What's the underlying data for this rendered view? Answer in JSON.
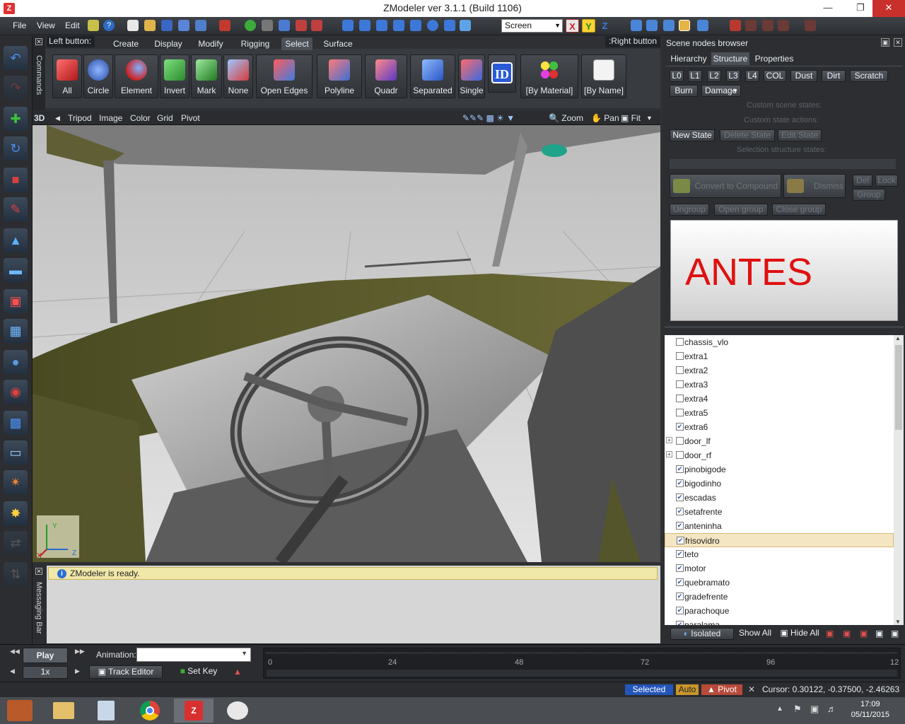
{
  "window": {
    "title": "ZModeler ver 3.1.1 (Build 1106)"
  },
  "menubar": {
    "items": [
      "File",
      "View",
      "Edit"
    ],
    "screen_dropdown": "Screen",
    "axes": [
      "X",
      "Y",
      "Z"
    ]
  },
  "commands_panel": {
    "vertical_label": "Commands",
    "left_button_label": "Left button:",
    "right_button_label": ":Right button",
    "tabs": [
      "Create",
      "Display",
      "Modify",
      "Rigging",
      "Select",
      "Surface"
    ],
    "active_tab": "Select",
    "buttons": [
      "All",
      "Circle",
      "Element",
      "Invert",
      "Mark",
      "None",
      "Open Edges",
      "Polyline",
      "Quadr",
      "Separated",
      "Single",
      "ID",
      "[By Material]",
      "[By Name]"
    ]
  },
  "viewport": {
    "mode": "3D",
    "menu": [
      "Tripod",
      "Image",
      "Color",
      "Grid",
      "Pivot"
    ],
    "right_tools": [
      "Zoom",
      "Pan",
      "Fit"
    ],
    "axes_gizmo": {
      "x": "X",
      "y": "Y",
      "z": "Z"
    }
  },
  "messaging": {
    "vertical_label": "Messaging Bar",
    "message": "ZModeler is ready."
  },
  "scene_browser": {
    "title": "Scene nodes browser",
    "tabs": [
      "Hierarchy",
      "Structure",
      "Properties"
    ],
    "active_tab": "Structure",
    "lod_buttons": [
      "L0",
      "L1",
      "L2",
      "L3",
      "L4",
      "COL",
      "Dust",
      "Dirt",
      "Scratch"
    ],
    "burn_label": "Burn",
    "damage_label": "Damage",
    "custom_scene_states": "Custom scene states:",
    "custom_state_actions": "Custom state actions:",
    "state_buttons": [
      "New State",
      "Delete State",
      "Edit State"
    ],
    "selection_structure_states": "Selection structure states:",
    "convert_label": "Convert to Compound",
    "dismiss_label": "Dismiss",
    "del_label": "Del",
    "lock_label": "Lock",
    "group_label": "Group",
    "group_buttons": [
      "Ungroup",
      "Open group",
      "Close group"
    ],
    "preview_text": "ANTES",
    "nodes": [
      {
        "name": "chassis_vlo",
        "checked": false,
        "expandable": false
      },
      {
        "name": "extra1",
        "checked": false,
        "expandable": false
      },
      {
        "name": "extra2",
        "checked": false,
        "expandable": false
      },
      {
        "name": "extra3",
        "checked": false,
        "expandable": false
      },
      {
        "name": "extra4",
        "checked": false,
        "expandable": false
      },
      {
        "name": "extra5",
        "checked": false,
        "expandable": false
      },
      {
        "name": "extra6",
        "checked": true,
        "expandable": false
      },
      {
        "name": "door_lf",
        "checked": false,
        "expandable": true
      },
      {
        "name": "door_rf",
        "checked": false,
        "expandable": true
      },
      {
        "name": "pinobigode",
        "checked": true,
        "expandable": false
      },
      {
        "name": "bigodinho",
        "checked": true,
        "expandable": false
      },
      {
        "name": "escadas",
        "checked": true,
        "expandable": false
      },
      {
        "name": "setafrente",
        "checked": true,
        "expandable": false
      },
      {
        "name": "anteninha",
        "checked": true,
        "expandable": false
      },
      {
        "name": "frisovidro",
        "checked": true,
        "expandable": false,
        "selected": true
      },
      {
        "name": "teto",
        "checked": true,
        "expandable": false
      },
      {
        "name": "motor",
        "checked": true,
        "expandable": false
      },
      {
        "name": "quebramato",
        "checked": true,
        "expandable": false
      },
      {
        "name": "gradefrente",
        "checked": true,
        "expandable": false
      },
      {
        "name": "parachoque",
        "checked": true,
        "expandable": false
      },
      {
        "name": "paralama",
        "checked": true,
        "expandable": false
      }
    ],
    "footer": {
      "isolated": "Isolated",
      "show_all": "Show All",
      "hide_all": "Hide All"
    }
  },
  "animation": {
    "play": "Play",
    "speed": "1x",
    "animation_label": "Animation:",
    "track_editor": "Track Editor",
    "set_key": "Set Key",
    "ticks": [
      "0",
      "24",
      "48",
      "72",
      "96",
      "12"
    ]
  },
  "status": {
    "selected": "Selected",
    "auto": "Auto",
    "pivot": "Pivot",
    "cursor": "Cursor: 0.30122, -0.37500, -2.46263"
  },
  "taskbar": {
    "time": "17:09",
    "date": "05/11/2015"
  },
  "colors": {
    "accent": "#2a6fd6",
    "preview_text": "#e01010",
    "panel": "#2c2e31",
    "status_selected": "#2356b8",
    "status_auto": "#c8962a",
    "status_pivot": "#b84a3a"
  }
}
